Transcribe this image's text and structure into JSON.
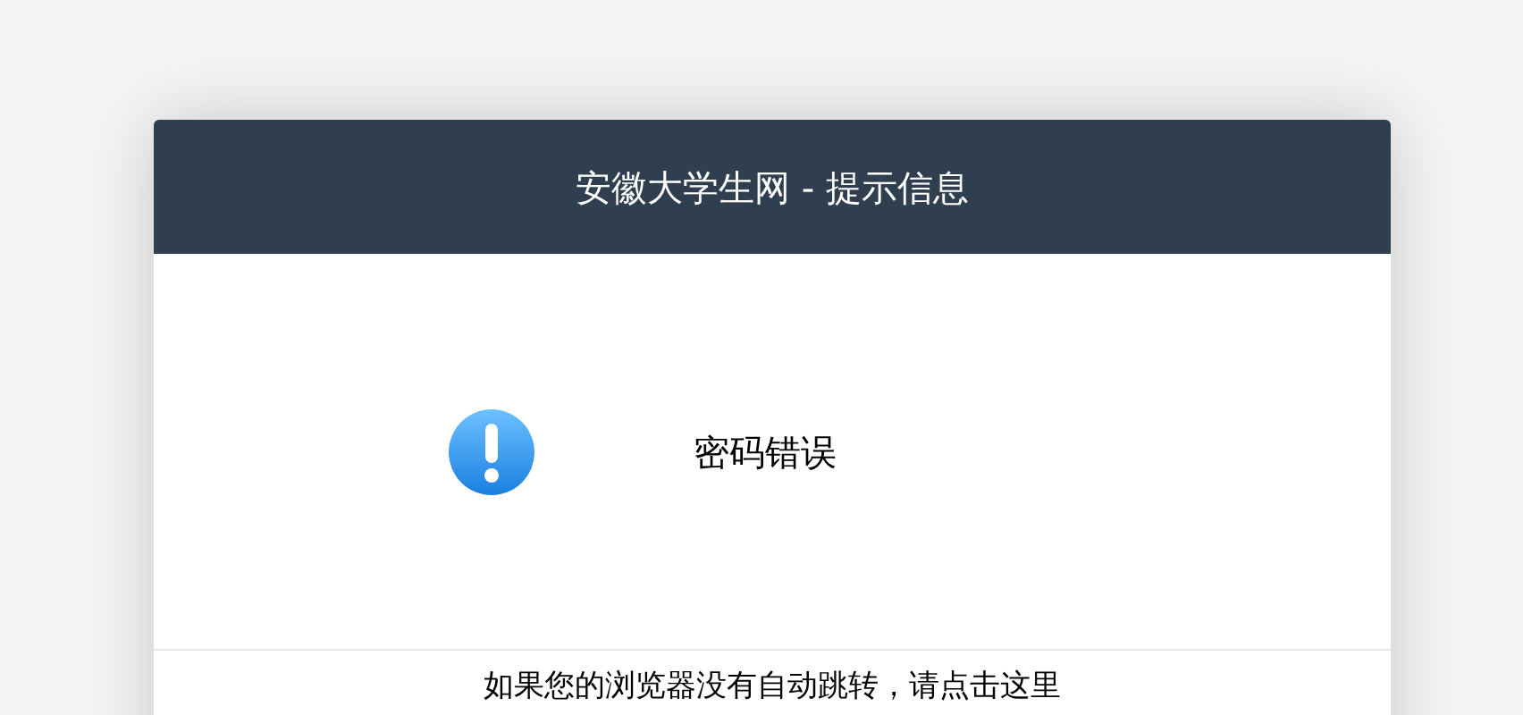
{
  "dialog": {
    "title": "安徽大学生网 - 提示信息",
    "message": "密码错误",
    "footer": "如果您的浏览器没有自动跳转，请点击这里"
  }
}
